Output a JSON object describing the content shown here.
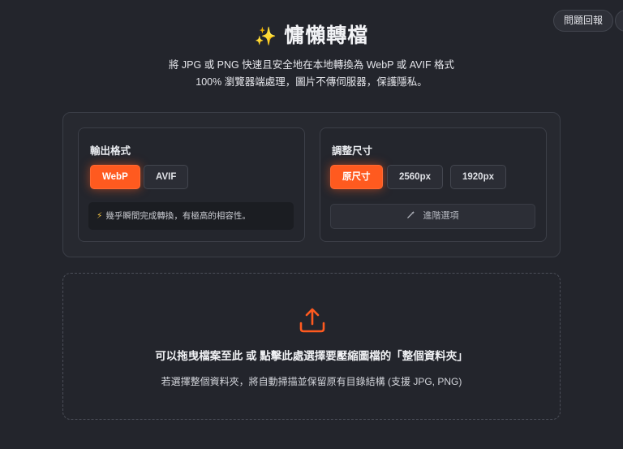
{
  "header": {
    "feedback_label": "問題回報",
    "sparkle_icon": "✨",
    "title": "慵懶轉檔",
    "subtitle_line1": "將 JPG 或 PNG 快速且安全地在本地轉換為 WebP 或 AVIF 格式",
    "subtitle_line2": "100% 瀏覽器端處理，圖片不傳伺服器，保護隱私。"
  },
  "format_card": {
    "title": "輸出格式",
    "options": [
      "WebP",
      "AVIF"
    ],
    "selected": "WebP",
    "hint_icon": "⚡",
    "hint": "幾乎瞬間完成轉換，有極高的相容性。"
  },
  "resize_card": {
    "title": "調整尺寸",
    "options": [
      "原尺寸",
      "2560px",
      "1920px"
    ],
    "selected": "原尺寸",
    "advanced_label": "進階選項"
  },
  "dropzone": {
    "main_text": "可以拖曳檔案至此 或 點擊此處選擇要壓縮圖檔的「整個資料夾」",
    "sub_text": "若選擇整個資料夾，將自動掃描並保留原有目錄結構 (支援 JPG, PNG)"
  },
  "colors": {
    "accent": "#ff5a1f",
    "background": "#23252c"
  }
}
